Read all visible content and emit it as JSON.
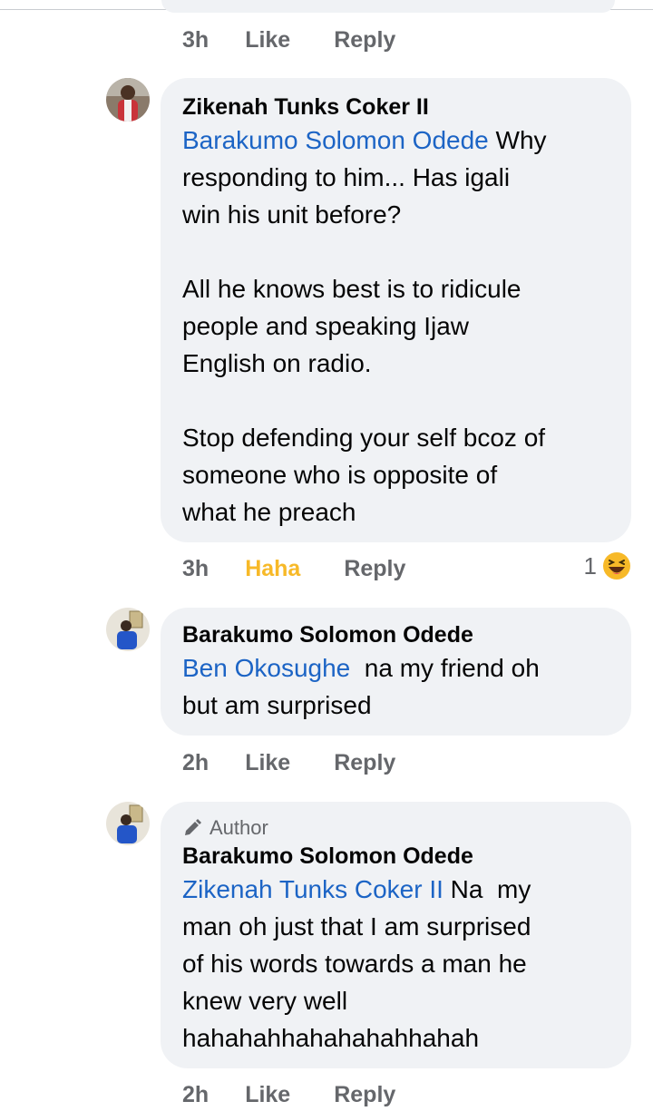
{
  "prev_comment_actions": {
    "time": "3h",
    "like": "Like",
    "reply": "Reply"
  },
  "comments": [
    {
      "name": "Zikenah Tunks Coker II",
      "mention": "Barakumo Solomon Odede",
      "text_after_mention": " Why\nresponding to him... Has igali\nwin his unit before?\n\nAll he knows best is to ridicule\npeople and speaking Ijaw\nEnglish on radio.\n\nStop defending your self bcoz of\nsomeone who is opposite of\nwhat he preach",
      "actions": {
        "time": "3h",
        "reaction_label": "Haha",
        "reply": "Reply"
      },
      "reaction_count": "1",
      "reaction_icon": "haha-emoji-icon"
    },
    {
      "name": "Barakumo Solomon Odede",
      "mention": "Ben Okosughe",
      "text_after_mention": "  na my friend oh\nbut am surprised",
      "actions": {
        "time": "2h",
        "like": "Like",
        "reply": "Reply"
      }
    },
    {
      "badge": "Author",
      "name": "Barakumo Solomon Odede",
      "mention": "Zikenah Tunks Coker II",
      "text_after_mention": " Na  my\nman oh just that I am surprised\nof his words towards a man he\nknew very well\nhahahahhahahahahhahah",
      "actions": {
        "time": "2h",
        "like": "Like",
        "reply": "Reply"
      }
    }
  ],
  "colors": {
    "bubble": "#f0f2f5",
    "mention": "#1c64c5",
    "meta": "#65676b",
    "haha": "#f7b928"
  }
}
